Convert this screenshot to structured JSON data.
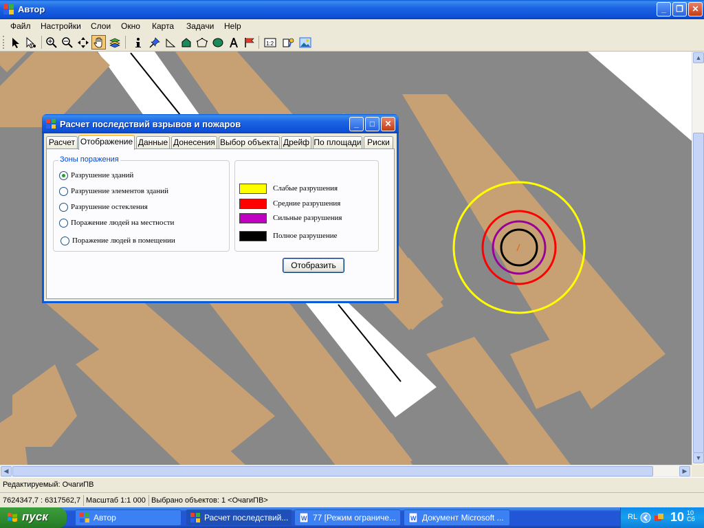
{
  "window": {
    "title": "Автор",
    "controls": {
      "minimize": "_",
      "maximize": "❐",
      "close": "✕"
    }
  },
  "menu": [
    "Файл",
    "Настройки",
    "Слои",
    "Окно",
    "Карта",
    "Задачи",
    "Help"
  ],
  "toolbar": {
    "tools": [
      "arrow-select-icon",
      "select-info-icon",
      "zoom-in-icon",
      "zoom-out-icon",
      "pan-move-icon",
      "hand-icon",
      "layers-icon",
      "info-icon",
      "pin-icon",
      "polyline-icon",
      "polygon-icon",
      "polygon-outline-icon",
      "ellipse-icon",
      "text-icon",
      "flag-icon",
      "scale-bar-icon",
      "settings-icon",
      "image-icon"
    ],
    "scale_glyph": "1:2"
  },
  "map": {
    "colors": {
      "building": "#c7a173",
      "ground": "#888888",
      "road": "#ffffff",
      "mark": "#e66a2a"
    },
    "zones": [
      {
        "name": "weak",
        "color": "#ffff00"
      },
      {
        "name": "medium",
        "color": "#ff0000"
      },
      {
        "name": "strong",
        "color": "#990099"
      },
      {
        "name": "full",
        "color": "#000000"
      }
    ]
  },
  "dialog": {
    "title": "Расчет последствий взрывов и пожаров",
    "tabs": [
      "Расчет",
      "Отображение",
      "Данные",
      "Донесения",
      "Выбор объекта",
      "Дрейф",
      "По площади",
      "Риски"
    ],
    "selected_tab": "Отображение",
    "zones_group": {
      "title": "Зоны поражения",
      "options": [
        {
          "label": "Разрушение зданий",
          "checked": true
        },
        {
          "label": "Разрушение элементов зданий",
          "checked": false
        },
        {
          "label": "Разрушение остекления",
          "checked": false
        },
        {
          "label": "Поражение людей на местности",
          "checked": false
        },
        {
          "label": "Поражение людей в помещении",
          "checked": false
        }
      ]
    },
    "legend": [
      {
        "label": "Слабые разрушения",
        "color": "#ffff00"
      },
      {
        "label": "Средние разрушения",
        "color": "#ff0000"
      },
      {
        "label": "Сильные разрушения",
        "color": "#c000c0"
      },
      {
        "label": "Полное разрушение",
        "color": "#000000"
      }
    ],
    "show_button": "Отобразить"
  },
  "status": {
    "editing": "Редактируемый: ОчагиПВ",
    "coords": "7624347,7 : 6317562,7",
    "scale": "Масштаб 1:1 000",
    "selected": "Выбрано объектов: 1 <ОчагиПВ>"
  },
  "taskbar": {
    "start": "пуск",
    "tasks": [
      {
        "label": "Автор",
        "active": false
      },
      {
        "label": "Расчет последствий...",
        "active": true
      },
      {
        "label": "77 [Режим ограниче...",
        "active": false
      },
      {
        "label": "Документ Microsoft ...",
        "active": false
      }
    ],
    "lang": "RL",
    "clock_hour": "10",
    "clock_min": "10",
    "clock_day": "Сб"
  }
}
